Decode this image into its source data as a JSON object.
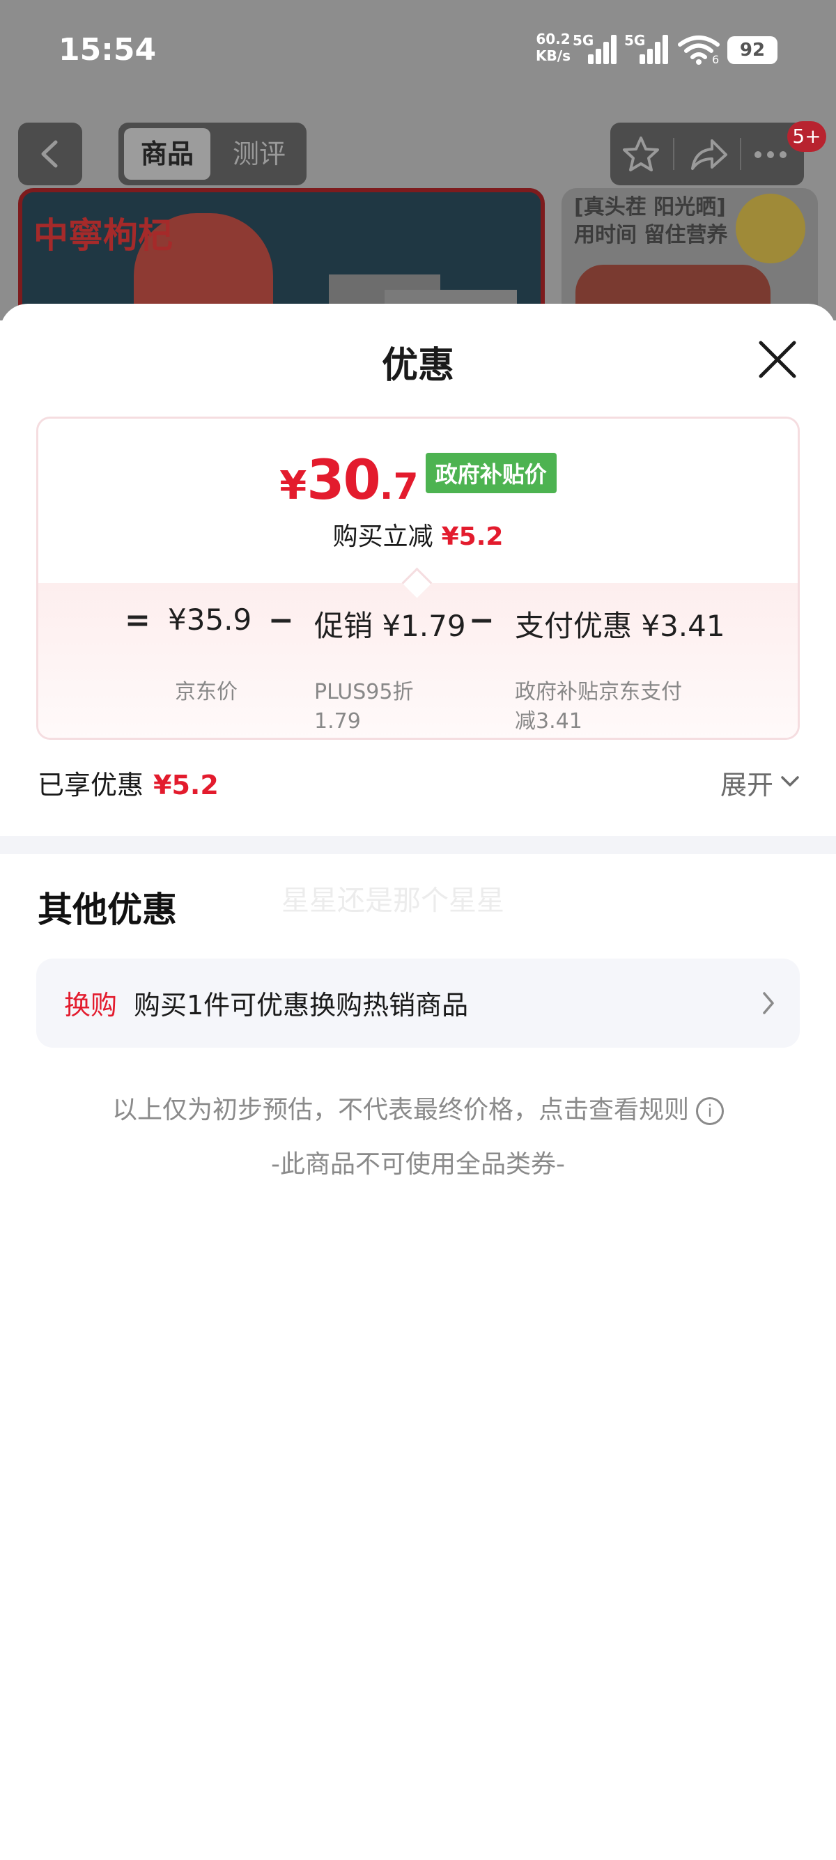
{
  "status_bar": {
    "time": "15:54",
    "net_speed_value": "60.2",
    "net_speed_unit": "KB/s",
    "sim1_label": "5G",
    "sim2_label": "5G",
    "wifi_sub": "6",
    "battery": "92"
  },
  "product_nav": {
    "tabs": [
      "商品",
      "测评"
    ],
    "active_tab": "商品",
    "cart_badge": "5+"
  },
  "background_images": {
    "hero_logo_text": "中寧枸杞",
    "side_card_text_line1": "[真头茬 阳光晒]",
    "side_card_text_line2": "用时间 留住营养"
  },
  "sheet": {
    "title": "优惠",
    "price": {
      "yen": "¥",
      "integer": "30",
      "decimal": ".7",
      "tag": "政府补贴价"
    },
    "instant_reduce": {
      "label": "购买立减",
      "amount": "¥5.2"
    },
    "breakdown": [
      {
        "operator": "=",
        "value": "¥35.9",
        "sub": "京东价"
      },
      {
        "operator": "−",
        "value": "促销 ¥1.79",
        "sub_line1": "PLUS95折",
        "sub_line2": "1.79"
      },
      {
        "operator": "−",
        "value": "支付优惠 ¥3.41",
        "sub_line1": "政府补贴京东支付",
        "sub_line2": "减3.41"
      }
    ],
    "enjoyed": {
      "label": "已享优惠",
      "amount": "¥5.2"
    },
    "expand_label": "展开",
    "other_section_title": "其他优惠",
    "watermark": "星星还是那个星星",
    "swap": {
      "tag": "换购",
      "text": "购买1件可优惠换购热销商品"
    },
    "note": "以上仅为初步预估，不代表最终价格，点击查看规则",
    "info_glyph": "i",
    "coupon_note": "-此商品不可使用全品类券-"
  },
  "colors": {
    "accent_red": "#e31b2d",
    "gov_green": "#4db351"
  }
}
